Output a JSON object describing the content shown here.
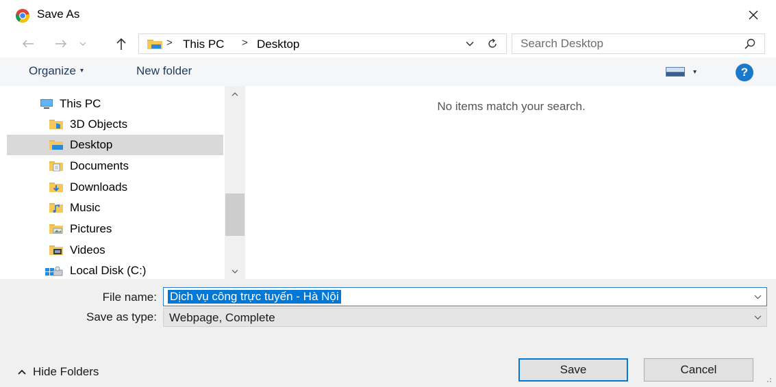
{
  "window": {
    "title": "Save As",
    "close_label": "×"
  },
  "nav": {
    "breadcrumb": [
      "This PC",
      "Desktop"
    ],
    "search_placeholder": "Search Desktop"
  },
  "toolbar": {
    "organize_label": "Organize",
    "new_folder_label": "New folder",
    "help_label": "?"
  },
  "tree": {
    "items": [
      {
        "label": "This PC",
        "icon": "computer-icon",
        "selected": false
      },
      {
        "label": "3D Objects",
        "icon": "3d-objects-folder-icon",
        "selected": false
      },
      {
        "label": "Desktop",
        "icon": "desktop-folder-icon",
        "selected": true
      },
      {
        "label": "Documents",
        "icon": "documents-folder-icon",
        "selected": false
      },
      {
        "label": "Downloads",
        "icon": "downloads-folder-icon",
        "selected": false
      },
      {
        "label": "Music",
        "icon": "music-folder-icon",
        "selected": false
      },
      {
        "label": "Pictures",
        "icon": "pictures-folder-icon",
        "selected": false
      },
      {
        "label": "Videos",
        "icon": "videos-folder-icon",
        "selected": false
      },
      {
        "label": "Local Disk (C:)",
        "icon": "local-disk-icon",
        "selected": false
      }
    ]
  },
  "content": {
    "empty_message": "No items match your search."
  },
  "form": {
    "file_name_label": "File name:",
    "file_name_value": "Dịch vụ công trực tuyến - Hà Nội",
    "save_type_label": "Save as type:",
    "save_type_value": "Webpage, Complete"
  },
  "footer": {
    "hide_folders_label": "Hide Folders",
    "save_label": "Save",
    "cancel_label": "Cancel"
  },
  "colors": {
    "accent": "#0078d7",
    "help_blue": "#1979ca",
    "selection_gray": "#d9d9d9",
    "bottom_panel": "#f0f0f0"
  }
}
